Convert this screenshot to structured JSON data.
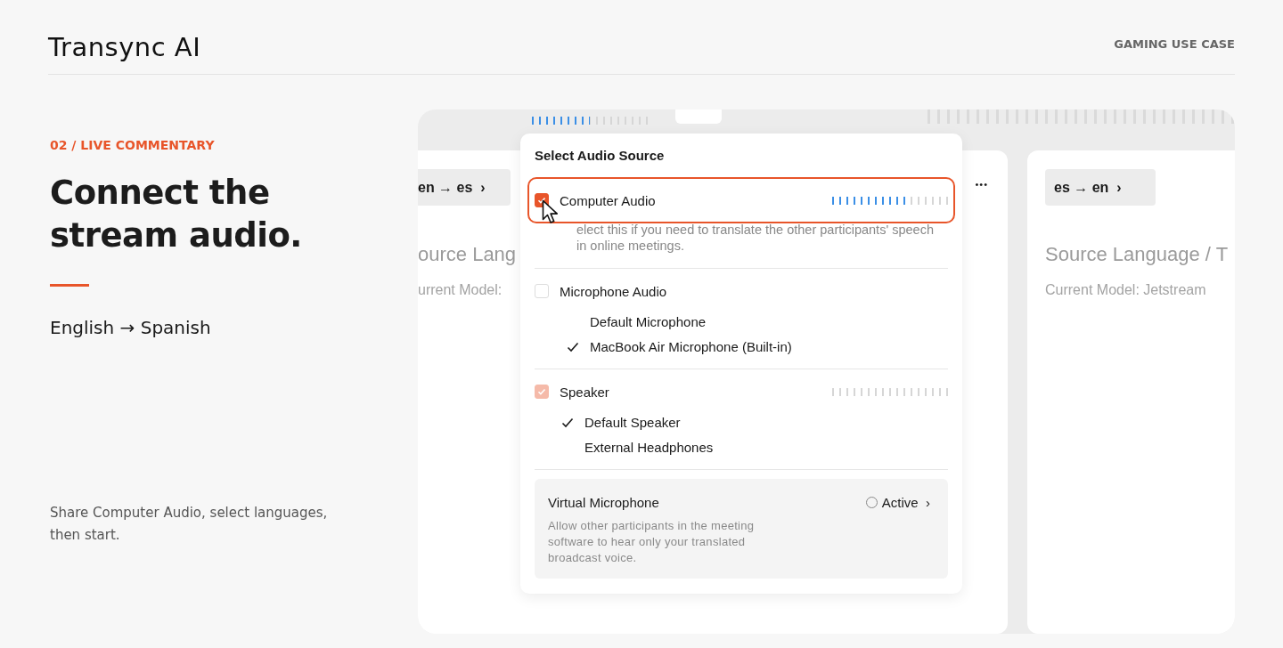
{
  "header": {
    "logo": "Transync AI",
    "link": "GAMING USE CASE"
  },
  "intro": {
    "eyebrow": "02 / LIVE COMMENTARY",
    "title_lines": [
      "Connect the",
      "stream audio."
    ],
    "languages": "English → Spanish",
    "caption": "Share Computer Audio, select languages, then start."
  },
  "mockup": {
    "top_meters": [
      {
        "level": 0.5
      },
      {
        "level": 0
      }
    ],
    "left_panel": {
      "chip": "en → es",
      "chevron": "›",
      "source_label": "ource Lang",
      "model_label": "urrent Model:",
      "more": "•••"
    },
    "right_panel": {
      "chip": "es → en",
      "chevron": "›",
      "source_label": "Source Language / T",
      "model_label": "Current Model: Jetstream"
    },
    "popup": {
      "title": "Select Audio Source",
      "sources": [
        {
          "label": "Computer Audio",
          "checked": true,
          "disabled": false,
          "highlighted": true,
          "level": 0.64,
          "description": "elect this if you need to translate the other participants' speech in online meetings."
        },
        {
          "label": "Microphone Audio",
          "checked": false,
          "disabled": false,
          "highlighted": false,
          "devices": [
            {
              "label": "Default Microphone",
              "selected": false
            },
            {
              "label": "MacBook Air Microphone (Built-in)",
              "selected": true
            }
          ]
        },
        {
          "label": "Speaker",
          "checked": true,
          "disabled": true,
          "highlighted": false,
          "level": 0,
          "devices": [
            {
              "label": "Default Speaker",
              "selected": true
            },
            {
              "label": "External Headphones",
              "selected": false
            }
          ]
        }
      ],
      "virtual": {
        "title": "Virtual Microphone",
        "description": "Allow other participants in the meeting software to hear only your translated broadcast voice.",
        "status": "Active",
        "active": false,
        "chevron": "›"
      }
    }
  }
}
